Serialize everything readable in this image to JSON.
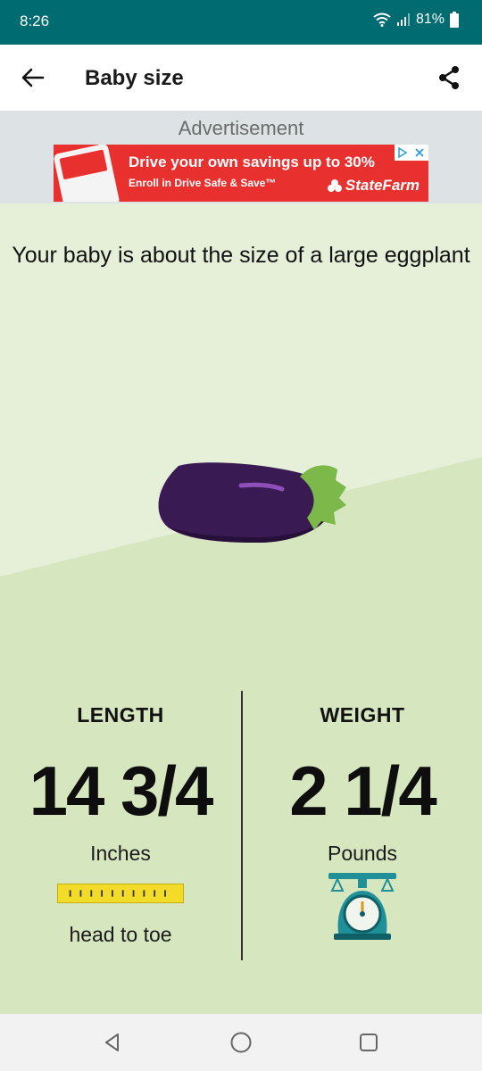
{
  "status_bar": {
    "time": "8:26",
    "battery": "81%",
    "icons": [
      "wifi-icon",
      "signal-icon",
      "battery-icon"
    ]
  },
  "app_bar": {
    "title": "Baby size",
    "back_icon": "arrow-left-icon",
    "share_icon": "share-icon"
  },
  "ad": {
    "label": "Advertisement",
    "headline": "Drive your own savings up to 30%",
    "subline": "Enroll in Drive Safe & Save™",
    "brand": "StateFarm",
    "colors": {
      "banner": "#e8312f",
      "text": "#ffffff"
    }
  },
  "main": {
    "size_text": "Your baby is about the size of a large eggplant",
    "fruit_icon": "eggplant-icon",
    "length": {
      "label": "LENGTH",
      "value": "14 3/4",
      "unit": "Inches",
      "detail": "head to toe",
      "icon": "measuring-tape-icon"
    },
    "weight": {
      "label": "WEIGHT",
      "value": "2 1/4",
      "unit": "Pounds",
      "icon": "scale-icon"
    },
    "colors": {
      "background_light": "#e6efd8",
      "background_dark": "#d6e6bf",
      "accent_teal": "#1f8f98",
      "ruler_yellow": "#f3db2a"
    }
  },
  "nav_bar": {
    "icons": [
      "back-triangle-icon",
      "home-circle-icon",
      "recents-square-icon"
    ]
  }
}
